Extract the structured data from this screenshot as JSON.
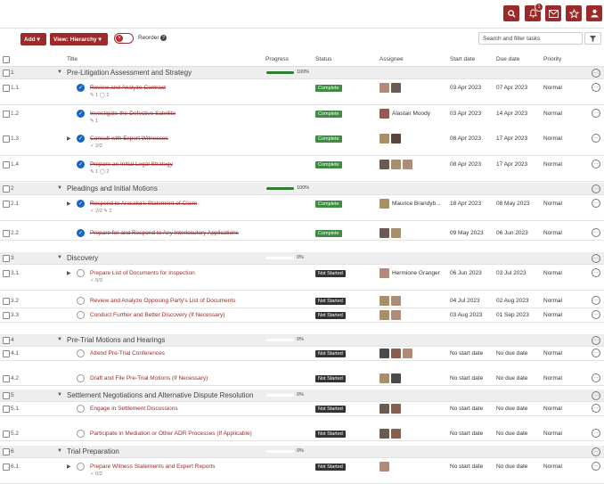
{
  "topbar": {
    "notification_count": "1",
    "icons": [
      "search-icon",
      "bell-icon",
      "mail-icon",
      "star-icon",
      "user-icon"
    ]
  },
  "toolbar": {
    "add_label": "Add ▾",
    "view_label": "View: Hierarchy ▾",
    "reorder_label": "Reorder",
    "search_placeholder": "Search and filter tasks"
  },
  "columns": {
    "title": "Title",
    "progress": "Progress",
    "status": "Status",
    "assignee": "Assignee",
    "start_date": "Start date",
    "due_date": "Due date",
    "priority": "Priority"
  },
  "groups": [
    {
      "num": "1",
      "title": "Pre-Litigation Assessment and Strategy",
      "pct": "100%",
      "progress": 1.0
    },
    {
      "num": "2",
      "title": "Pleadings and Initial Motions",
      "pct": "100%",
      "progress": 1.0
    },
    {
      "num": "3",
      "title": "Discovery",
      "pct": "0%",
      "progress": 0
    },
    {
      "num": "4",
      "title": "Pre-Trial Motions and Hearings",
      "pct": "0%",
      "progress": 0
    },
    {
      "num": "5",
      "title": "Settlement Negotiations and Alternative Dispute Resolution",
      "pct": "0%",
      "progress": 0
    },
    {
      "num": "6",
      "title": "Trial Preparation",
      "pct": "0%",
      "progress": 0
    }
  ],
  "tasks": [
    {
      "num": "1.1",
      "title": "Review and Analyze Contract",
      "meta": "✎ 1  ◯ 2",
      "status": "Complete",
      "assignee": "",
      "start": "03 Apr 2023",
      "due": "07 Apr 2023",
      "priority": "Normal"
    },
    {
      "num": "1.2",
      "title": "Investigate the Defective Satellite",
      "meta": "✎ 1",
      "status": "Complete",
      "assignee": "Alastair Moody",
      "start": "03 Apr 2023",
      "due": "14 Apr 2023",
      "priority": "Normal"
    },
    {
      "num": "1.3",
      "title": "Consult with Expert Witnesses",
      "meta": "✓ 2/2",
      "status": "Complete",
      "assignee": "",
      "start": "08 Apr 2023",
      "due": "17 Apr 2023",
      "priority": "Normal"
    },
    {
      "num": "1.4",
      "title": "Prepare an Initial Legal Strategy",
      "meta": "✎ 1  ◯ 2",
      "status": "Complete",
      "assignee": "",
      "start": "08 Apr 2023",
      "due": "17 Apr 2023",
      "priority": "Normal"
    },
    {
      "num": "2.1",
      "title": "Respond to Arasaka's Statement of Claim",
      "meta": "✓ 2/2  ✎ 2",
      "status": "Complete",
      "assignee": "Maurice Brandyb...",
      "start": "18 Apr 2023",
      "due": "08 May 2023",
      "priority": "Normal"
    },
    {
      "num": "2.2",
      "title": "Prepare for and Respond to Any Interlocutory Applications",
      "meta": "",
      "status": "Complete",
      "assignee": "",
      "start": "09 May 2023",
      "due": "06 Jun 2023",
      "priority": "Normal"
    },
    {
      "num": "3.1",
      "title": "Prepare List of Documents for Inspection",
      "meta": "✓ 0/3",
      "status": "Not Started",
      "assignee": "Hermione Granger",
      "start": "06 Jun 2023",
      "due": "03 Jul 2023",
      "priority": "Normal"
    },
    {
      "num": "3.2",
      "title": "Review and Analyze Opposing Party's List of Documents",
      "meta": "",
      "status": "Not Started",
      "assignee": "",
      "start": "04 Jul 2023",
      "due": "02 Aug 2023",
      "priority": "Normal"
    },
    {
      "num": "3.3",
      "title": "Conduct Further and Better Discovery (If Necessary)",
      "meta": "",
      "status": "Not Started",
      "assignee": "",
      "start": "03 Aug 2023",
      "due": "01 Sep 2023",
      "priority": "Normal"
    },
    {
      "num": "4.1",
      "title": "Attend Pre-Trial Conferences",
      "meta": "",
      "status": "Not Started",
      "assignee": "",
      "start": "No start date",
      "due": "No due date",
      "priority": "Normal"
    },
    {
      "num": "4.2",
      "title": "Draft and File Pre-Trial Motions (If Necessary)",
      "meta": "",
      "status": "Not Started",
      "assignee": "",
      "start": "No start date",
      "due": "No due date",
      "priority": "Normal"
    },
    {
      "num": "5.1",
      "title": "Engage in Settlement Discussions",
      "meta": "",
      "status": "Not Started",
      "assignee": "",
      "start": "No start date",
      "due": "No due date",
      "priority": "Normal"
    },
    {
      "num": "5.2",
      "title": "Participate in Mediation or Other ADR Processes (If Applicable)",
      "meta": "",
      "status": "Not Started",
      "assignee": "",
      "start": "No start date",
      "due": "No due date",
      "priority": "Normal"
    },
    {
      "num": "6.1",
      "title": "Prepare Witness Statements and Expert Reports",
      "meta": "✓ 0/2",
      "status": "Not Started",
      "assignee": "",
      "start": "No start date",
      "due": "No due date",
      "priority": "Normal"
    }
  ],
  "colors": {
    "brand": "#9c2a2a",
    "complete": "#3d8c40",
    "notstarted": "#333333",
    "check": "#1565c0"
  }
}
